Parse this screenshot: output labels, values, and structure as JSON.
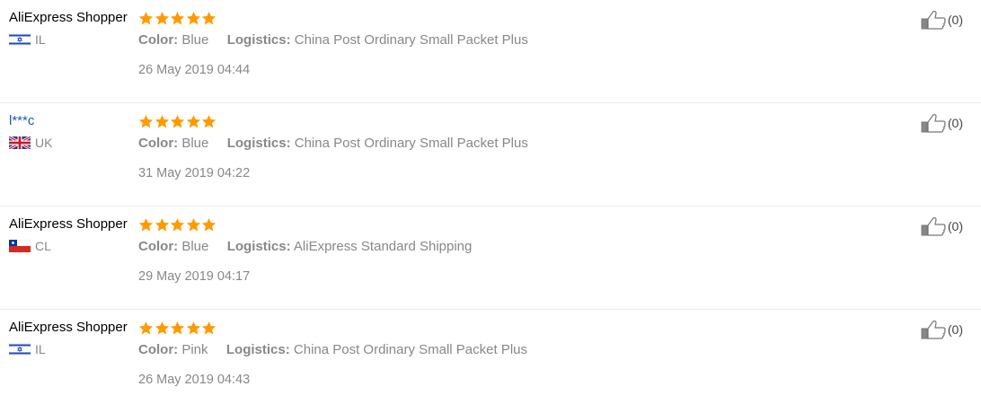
{
  "reviews": [
    {
      "user_name": "AliExpress Shopper",
      "user_is_link": false,
      "country": "IL",
      "flag": "israel-flag",
      "rating": 5,
      "color_label": "Color:",
      "color_value": "Blue",
      "logistics_label": "Logistics:",
      "logistics_value": "China Post Ordinary Small Packet Plus",
      "date": "26 May 2019 04:44",
      "helpful_count": "(0)"
    },
    {
      "user_name": "l***c",
      "user_is_link": true,
      "country": "UK",
      "flag": "uk-flag",
      "rating": 5,
      "color_label": "Color:",
      "color_value": "Blue",
      "logistics_label": "Logistics:",
      "logistics_value": "China Post Ordinary Small Packet Plus",
      "date": "31 May 2019 04:22",
      "helpful_count": "(0)"
    },
    {
      "user_name": "AliExpress Shopper",
      "user_is_link": false,
      "country": "CL",
      "flag": "chile-flag",
      "rating": 5,
      "color_label": "Color:",
      "color_value": "Blue",
      "logistics_label": "Logistics:",
      "logistics_value": "AliExpress Standard Shipping",
      "date": "29 May 2019 04:17",
      "helpful_count": "(0)"
    },
    {
      "user_name": "AliExpress Shopper",
      "user_is_link": false,
      "country": "IL",
      "flag": "israel-flag",
      "rating": 5,
      "color_label": "Color:",
      "color_value": "Pink",
      "logistics_label": "Logistics:",
      "logistics_value": "China Post Ordinary Small Packet Plus",
      "date": "26 May 2019 04:43",
      "helpful_count": "(0)"
    }
  ],
  "colors": {
    "star": "#ff9a00",
    "link": "#1b5dad",
    "muted_text": "#888888",
    "divider": "#ececec"
  },
  "icons": {
    "star": "star-icon",
    "helpful": "thumbs-up-icon"
  }
}
